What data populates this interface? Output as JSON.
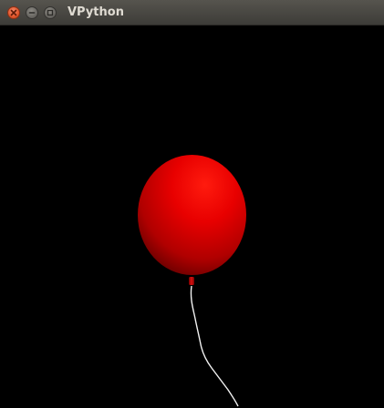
{
  "window": {
    "title": "VPython",
    "buttons": {
      "close_icon": "close-icon",
      "minimize_icon": "minimize-icon",
      "maximize_icon": "maximize-icon"
    }
  },
  "scene": {
    "background_color": "#000000",
    "balloon": {
      "color": "#ff0000",
      "highlight_color": "#ff2a1a",
      "shadow_color": "#5a0000"
    },
    "string": {
      "color": "#ffffff"
    }
  }
}
